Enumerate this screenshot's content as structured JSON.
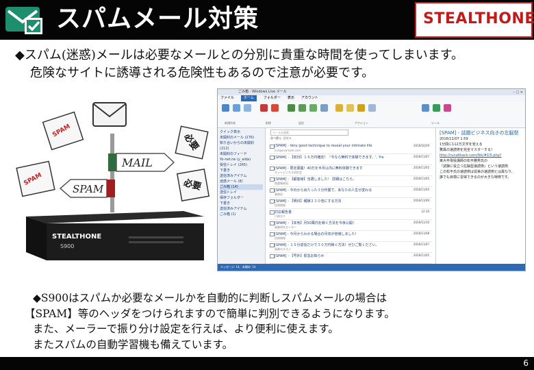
{
  "header": {
    "title": "スパムメール対策",
    "logo": "STEALTHONE",
    "icon": "mail-check-icon",
    "bg_color": "#050505",
    "brand_color": "#c21b1b"
  },
  "intro": {
    "line1": "◆スパム(迷惑)メールは必要なメールとの分別に貴重な時間を使ってしまいます。",
    "line2": "危険なサイトに誘導される危険性もあるので注意が必要です。"
  },
  "diagram": {
    "sign_mail": "MAIL",
    "sign_spam": "SPAM",
    "needed_label": "必要",
    "spam_stamp": "SPAM",
    "device_brand": "STEALTHONE",
    "device_model": "S900"
  },
  "mail_client": {
    "window_title": "ごみ箱 - Windows Live メール",
    "tabs": [
      "ファイル",
      "ホーム",
      "フォルダー",
      "表示",
      "アカウント"
    ],
    "ribbon_groups": [
      "新規作成",
      "削除",
      "返信",
      "アクション",
      "ツール"
    ],
    "folders": [
      "クイック表示",
      "未開封のメール (276)",
      "知り合いからの未開封 (212)",
      "未開封のフィード",
      "",
      "Yo-net.ne (y_aida)",
      "受信トレイ (265)",
      "下書き",
      "送信済みアイテム",
      "迷惑メール (8)",
      "ごみ箱 (14)",
      "送信トレイ",
      "保存フォルダー",
      "下書き",
      "送信済みアイテム",
      "ごみ箱 (1)"
    ],
    "search_placeholder": "メールの検索",
    "sort_label": "並べ替え: 日付 ▾",
    "messages": [
      {
        "subject": "[SPAM] - Very good technique to reveal your intimate life",
        "from": "sun@example.com",
        "date": "2016/10/29"
      },
      {
        "subject": "[SPAM] - 【初日】１６万円確定！『今なら無料で体験できます。', 'from': 'マネーセミナー事務局",
        "from": "",
        "date": "2016/11/07"
      },
      {
        "subject": "[SPAM] - 限定募集！40万を半月以内に無料体験できます",
        "from": "ネットビジネス研究会",
        "date": "2016/11/05"
      },
      {
        "subject": "[SPAM] - 【顧客様】当選しました！ 詳細はこちら。",
        "from": "抽選事務局",
        "date": "2016/11/05"
      },
      {
        "subject": "[SPAM] - 今日から出たった３分作業で、あなたの人生が変わる",
        "from": "事務局",
        "date": "2016/11/05"
      },
      {
        "subject": "[SPAM] - 【明日】報酬２３０倍にする方法",
        "from": "投資情報",
        "date": "2016/11/09"
      },
      {
        "subject": "対応報告書",
        "from": "川原大介",
        "date": "12:10"
      },
      {
        "subject": "[SPAM] - 【本気】月50萬円を稼ぐ方法を今夜公開！",
        "from": "副業研究センター",
        "date": "2016/11/10"
      },
      {
        "subject": "[SPAM] - 今月からわかる場合の月収が倍増しました！",
        "from": "投資情報",
        "date": "2016/11/08"
      },
      {
        "subject": "[SPAM] - １５分返信だけで３０万円稼ぐ方法！ぜひご覧ください。",
        "from": "副業のススメ",
        "date": "2016/11/07"
      },
      {
        "subject": "[SPAM] - 【号外】緊急お知らせ",
        "from": "",
        "date": "2016/11/05"
      }
    ],
    "reading": {
      "heading": "[SPAM] - 話題ビジネス向きの左脳型",
      "meta": "2016/11/07 1:59",
      "line1": "1分間に112万文字を覚える",
      "line2": "驚異の速読術を完全マスターする！",
      "link": "http://runaltkack.com/fkk/#1l5.php?",
      "line3": "東大卒現役講師の松平勝男氏の",
      "line4": "『試験に役立つ左脳型速読術』という速読術",
      "line5": "この松平氏の速読術は従来の速読術とは異なり、",
      "line6": "誰でも目標に習得できるのが大きな特徴です。"
    },
    "status_text": "メッセージ: 14、未開封: 14"
  },
  "summary": {
    "line1": "◆S900はスパムか必要なメールかを自動的に判断しスパムメールの場合は",
    "line2": "【SPAM】等のヘッダをつけられますので簡単に判別できるようになります。",
    "line3": "また、メーラーで振り分け設定を行えば、より便利に使えます。",
    "line4": "またスパムの自動学習機も備えています。"
  },
  "footer": {
    "page": "6"
  }
}
